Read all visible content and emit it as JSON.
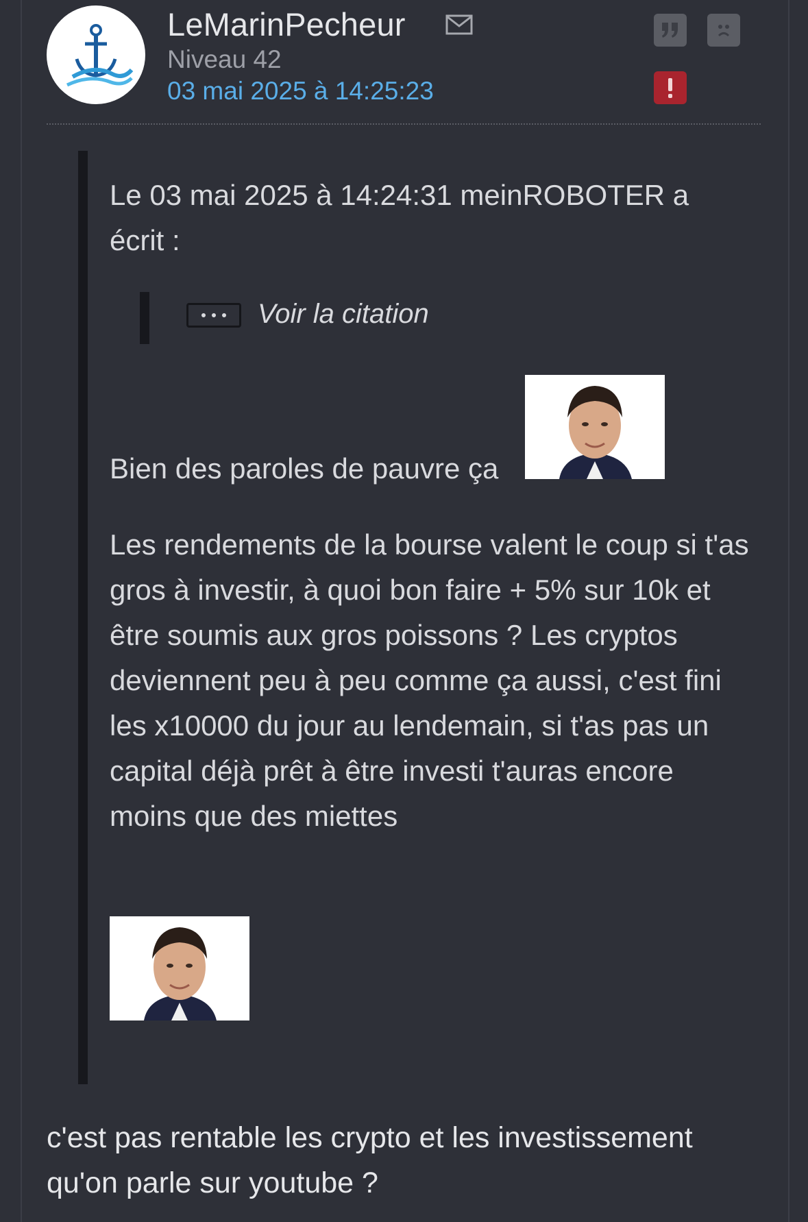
{
  "post": {
    "author": "LeMarinPecheur",
    "level": "Niveau 42",
    "date": "03 mai 2025 à 14:25:23",
    "actions": {
      "quote_icon": "quote-icon",
      "sad_icon": "sad-face-icon",
      "alert_icon": "exclamation-icon"
    }
  },
  "quote": {
    "header": "Le 03 mai 2025 à 14:24:31 meinROBOTER a écrit :",
    "nested_toggle": "Voir la citation",
    "line1": "Bien des paroles de pauvre ça",
    "paragraph": "Les rendements de la bourse valent le coup si t'as gros à investir, à quoi bon faire + 5% sur 10k et être soumis aux gros poissons ? Les cryptos deviennent peu à peu comme ça aussi, c'est fini les x10000 du jour au lendemain, si t'as pas un capital déjà prêt à être investi t'auras encore moins que des miettes"
  },
  "reply": {
    "text": "c'est pas rentable les crypto et les investissement qu'on parle sur youtube ?"
  },
  "colors": {
    "background": "#2e3038",
    "date_link": "#5aaee8",
    "alert_red": "#a9242e",
    "quote_bar": "#17181d"
  }
}
